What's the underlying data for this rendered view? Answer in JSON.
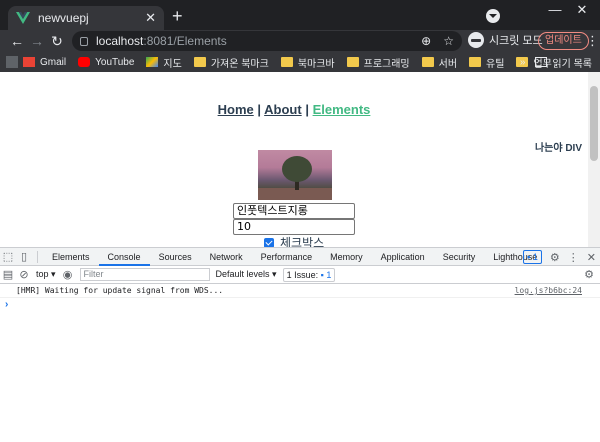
{
  "browser": {
    "tab_title": "newvuepj",
    "new_tab": "+",
    "url_host": "localhost",
    "url_path": ":8081/Elements",
    "incognito_label": "시크릿 모드",
    "update_label": "업데이트",
    "window_controls": [
      "—",
      "☐",
      "✕"
    ]
  },
  "bookmarks": {
    "items": [
      {
        "label": "Gmail",
        "icon": "gmail-icon"
      },
      {
        "label": "YouTube",
        "icon": "youtube-icon"
      },
      {
        "label": "지도",
        "icon": "maps-icon"
      },
      {
        "label": "가져온 북마크",
        "icon": "folder-icon"
      },
      {
        "label": "북마크바",
        "icon": "folder-icon"
      },
      {
        "label": "프로그래밍",
        "icon": "folder-icon"
      },
      {
        "label": "서버",
        "icon": "folder-icon"
      },
      {
        "label": "유틸",
        "icon": "folder-icon"
      },
      {
        "label": "업무",
        "icon": "folder-icon"
      }
    ],
    "overflow": "»",
    "reading_list": "읽기 목록"
  },
  "page": {
    "nav": {
      "home": "Home",
      "about": "About",
      "elements": "Elements",
      "sep": "|"
    },
    "div_label": "나는야 DIV",
    "input_text_value": "인풋텍스트지롱",
    "input_number_value": "10",
    "checkbox_label": "체크박스"
  },
  "devtools": {
    "tabs": [
      "Elements",
      "Console",
      "Sources",
      "Network",
      "Performance",
      "Memory",
      "Application",
      "Security",
      "Lighthouse"
    ],
    "active_tab": "Console",
    "message_count": "1",
    "context": "top ▾",
    "filter_placeholder": "Filter",
    "levels": "Default levels ▾",
    "issue_label": "1 Issue:",
    "issue_count": "1",
    "log_message": "[HMR] Waiting for update signal from WDS...",
    "log_source": "log.js?b6bc:24",
    "prompt": "›"
  },
  "colors": {
    "chrome_dark": "#202124",
    "chrome_toolbar": "#35363a",
    "vue_green": "#42b983",
    "text": "#2c3e50",
    "accent_blue": "#1a73e8"
  }
}
